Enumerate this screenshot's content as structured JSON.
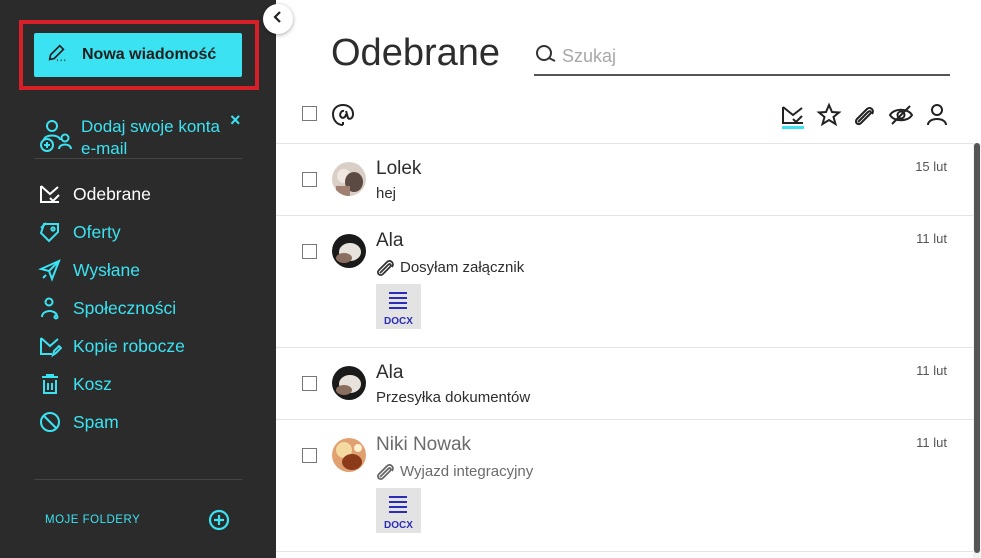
{
  "sidebar": {
    "compose_label": "Nowa wiadomość",
    "add_accounts_text": "Dodaj swoje konta e-mail",
    "close_symbol": "×",
    "items": [
      {
        "label": "Odebrane",
        "icon": "inbox-icon",
        "active": true
      },
      {
        "label": "Oferty",
        "icon": "offers-tag-icon",
        "active": false
      },
      {
        "label": "Wysłane",
        "icon": "sent-plane-icon",
        "active": false
      },
      {
        "label": "Społeczności",
        "icon": "social-icon",
        "active": false
      },
      {
        "label": "Kopie robocze",
        "icon": "drafts-icon",
        "active": false
      },
      {
        "label": "Kosz",
        "icon": "trash-icon",
        "active": false
      },
      {
        "label": "Spam",
        "icon": "spam-icon",
        "active": false
      }
    ],
    "my_folders": "MOJE FOLDERY"
  },
  "main": {
    "title": "Odebrane",
    "search_placeholder": "Szukaj",
    "toolbar_icons": [
      "mention-icon",
      "inbox-filter-icon",
      "star-icon",
      "attachment-filter-icon",
      "unread-filter-icon",
      "contacts-filter-icon"
    ]
  },
  "messages": [
    {
      "sender": "Lolek",
      "subject": "hej",
      "date": "15 lut",
      "attachment": null,
      "has_clip": false,
      "read": false
    },
    {
      "sender": "Ala",
      "subject": "Dosyłam załącznik",
      "date": "11 lut",
      "attachment": "DOCX",
      "has_clip": true,
      "read": false
    },
    {
      "sender": "Ala",
      "subject": "Przesyłka dokumentów",
      "date": "11 lut",
      "attachment": null,
      "has_clip": false,
      "read": false
    },
    {
      "sender": "Niki Nowak",
      "subject": "Wyjazd integracyjny",
      "date": "11 lut",
      "attachment": "DOCX",
      "has_clip": true,
      "read": true
    }
  ],
  "colors": {
    "accent": "#3be3f2",
    "sidebar_bg": "#2b2b2b",
    "highlight": "#d61f26",
    "docx_blue": "#2b2bb8"
  }
}
